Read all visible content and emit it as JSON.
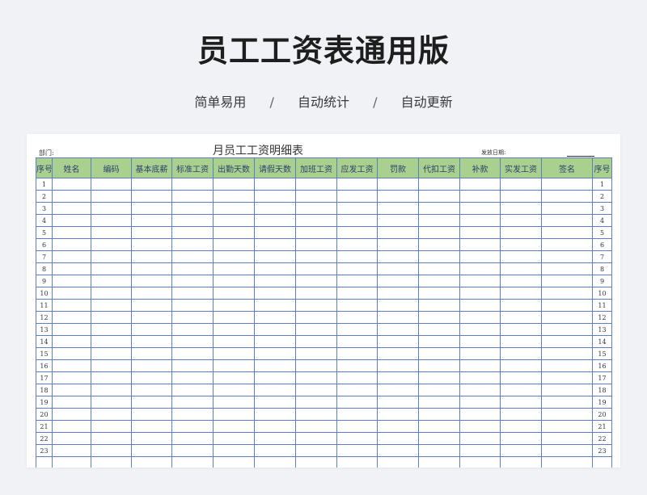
{
  "header": {
    "title": "员工工资表通用版",
    "features": [
      "简单易用",
      "自动统计",
      "自动更新"
    ],
    "separator": "/"
  },
  "sheet": {
    "dept_label": "部门:",
    "title": "月员工工资明细表",
    "date_label": "发放日期:",
    "columns": [
      "序号",
      "姓名",
      "编码",
      "基本底薪",
      "标准工资",
      "出勤天数",
      "请假天数",
      "加班工资",
      "应发工资",
      "罚款",
      "代扣工资",
      "补款",
      "实发工资",
      "签名",
      "序号"
    ],
    "row_numbers": [
      "1",
      "2",
      "3",
      "4",
      "5",
      "6",
      "7",
      "8",
      "9",
      "10",
      "11",
      "12",
      "13",
      "14",
      "15",
      "16",
      "17",
      "18",
      "19",
      "20",
      "21",
      "22",
      "23"
    ]
  },
  "colors": {
    "header_fill": "#a9d08e",
    "grid_line": "#5b7fc4",
    "page_bg": "#f0f2f5"
  }
}
